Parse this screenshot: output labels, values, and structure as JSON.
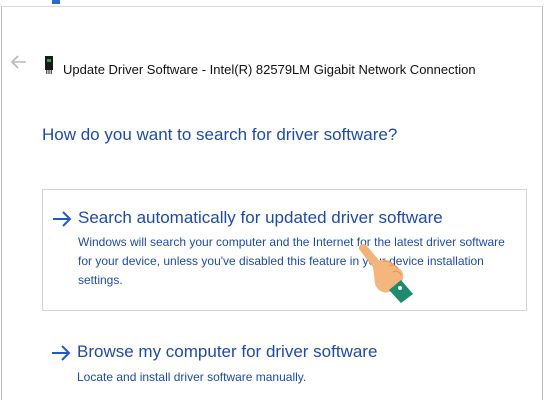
{
  "window": {
    "title": "Update Driver Software - Intel(R) 82579LM Gigabit Network Connection"
  },
  "main": {
    "heading": "How do you want to search for driver software?",
    "options": [
      {
        "title": "Search automatically for updated driver software",
        "description": "Windows will search your computer and the Internet for the latest driver software for your device, unless you've disabled this feature in your device installation settings."
      },
      {
        "title": "Browse my computer for driver software",
        "description": "Locate and install driver software manually."
      }
    ]
  },
  "icons": {
    "back": "back-arrow-icon",
    "device": "network-adapter-icon",
    "option_arrow": "right-arrow-icon",
    "cursor": "hand-pointer-icon"
  },
  "colors": {
    "link_blue": "#1e4aa8",
    "arrow_blue": "#1e5bc6",
    "border": "#d3d3d3",
    "hand_skin": "#f2b37a",
    "hand_cuff": "#1e8a6e"
  }
}
